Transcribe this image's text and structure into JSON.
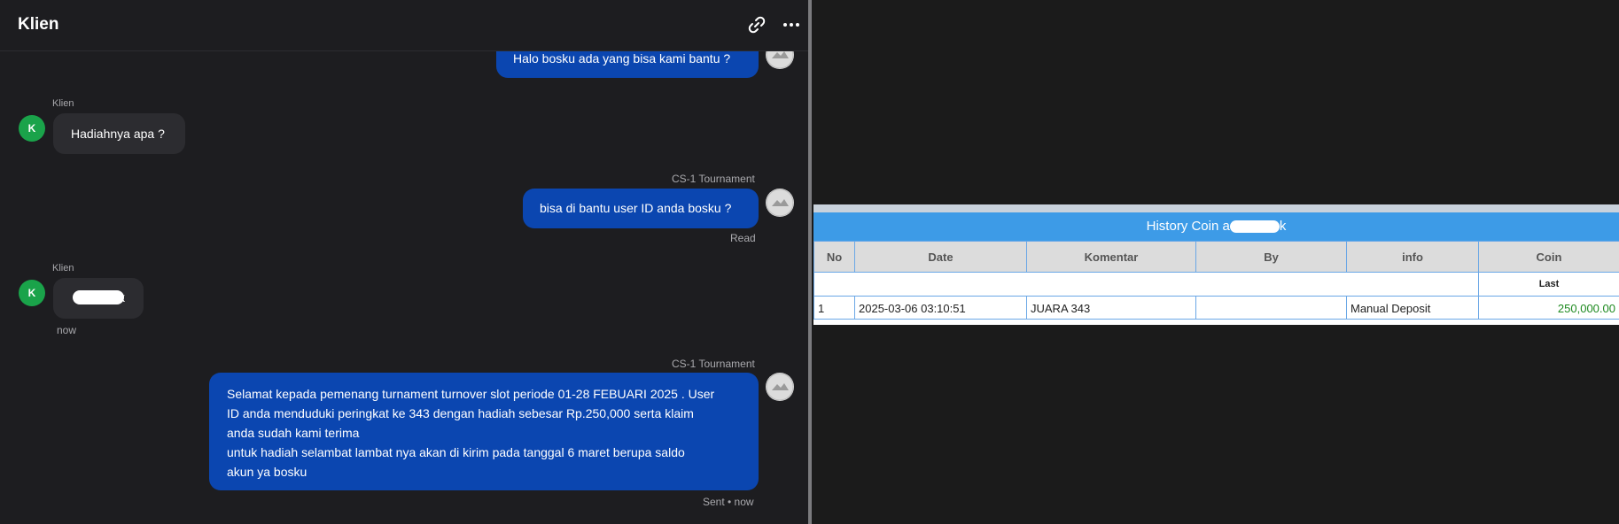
{
  "chat": {
    "title": "Klien",
    "messages": [
      {
        "text": "Halo bosku ada yang bisa kami bantu ?"
      },
      {
        "sender": "Klien",
        "avatar": "K",
        "text": "Hadiahnya apa ?"
      },
      {
        "sender": "CS-1 Tournament",
        "text": "bisa di bantu user ID anda bosku ?",
        "status": "Read"
      },
      {
        "sender": "Klien",
        "avatar": "K",
        "text": "k",
        "time": "now"
      },
      {
        "sender": "CS-1 Tournament",
        "lines": [
          "Selamat kepada pemenang turnament turnover slot periode 01-28 FEBUARI 2025 . User",
          "ID anda menduduki peringkat ke 343 dengan hadiah sebesar Rp.250,000 serta klaim",
          "anda sudah kami terima",
          "untuk hadiah selambat lambat nya akan di kirim pada tanggal 6 maret berupa saldo",
          "akun ya bosku"
        ],
        "status": "Sent • now"
      }
    ]
  },
  "history": {
    "title": "History Coin a",
    "title_suffix": "k",
    "columns": [
      "No",
      "Date",
      "Komentar",
      "By",
      "info",
      "Coin"
    ],
    "subheader": "Last",
    "rows": [
      {
        "no": "1",
        "date": "2025-03-06 03:10:51",
        "komentar": "JUARA 343",
        "by": "",
        "info": "Manual Deposit",
        "coin": "250,000.00"
      }
    ]
  },
  "colors": {
    "accent": "#0b46b0",
    "incoming": "#2c2c30",
    "avatar_green": "#1aa34a",
    "table_header": "#3d9be7",
    "coin_green": "#1e8a20"
  },
  "icons": [
    "link-icon",
    "more-options-icon"
  ]
}
